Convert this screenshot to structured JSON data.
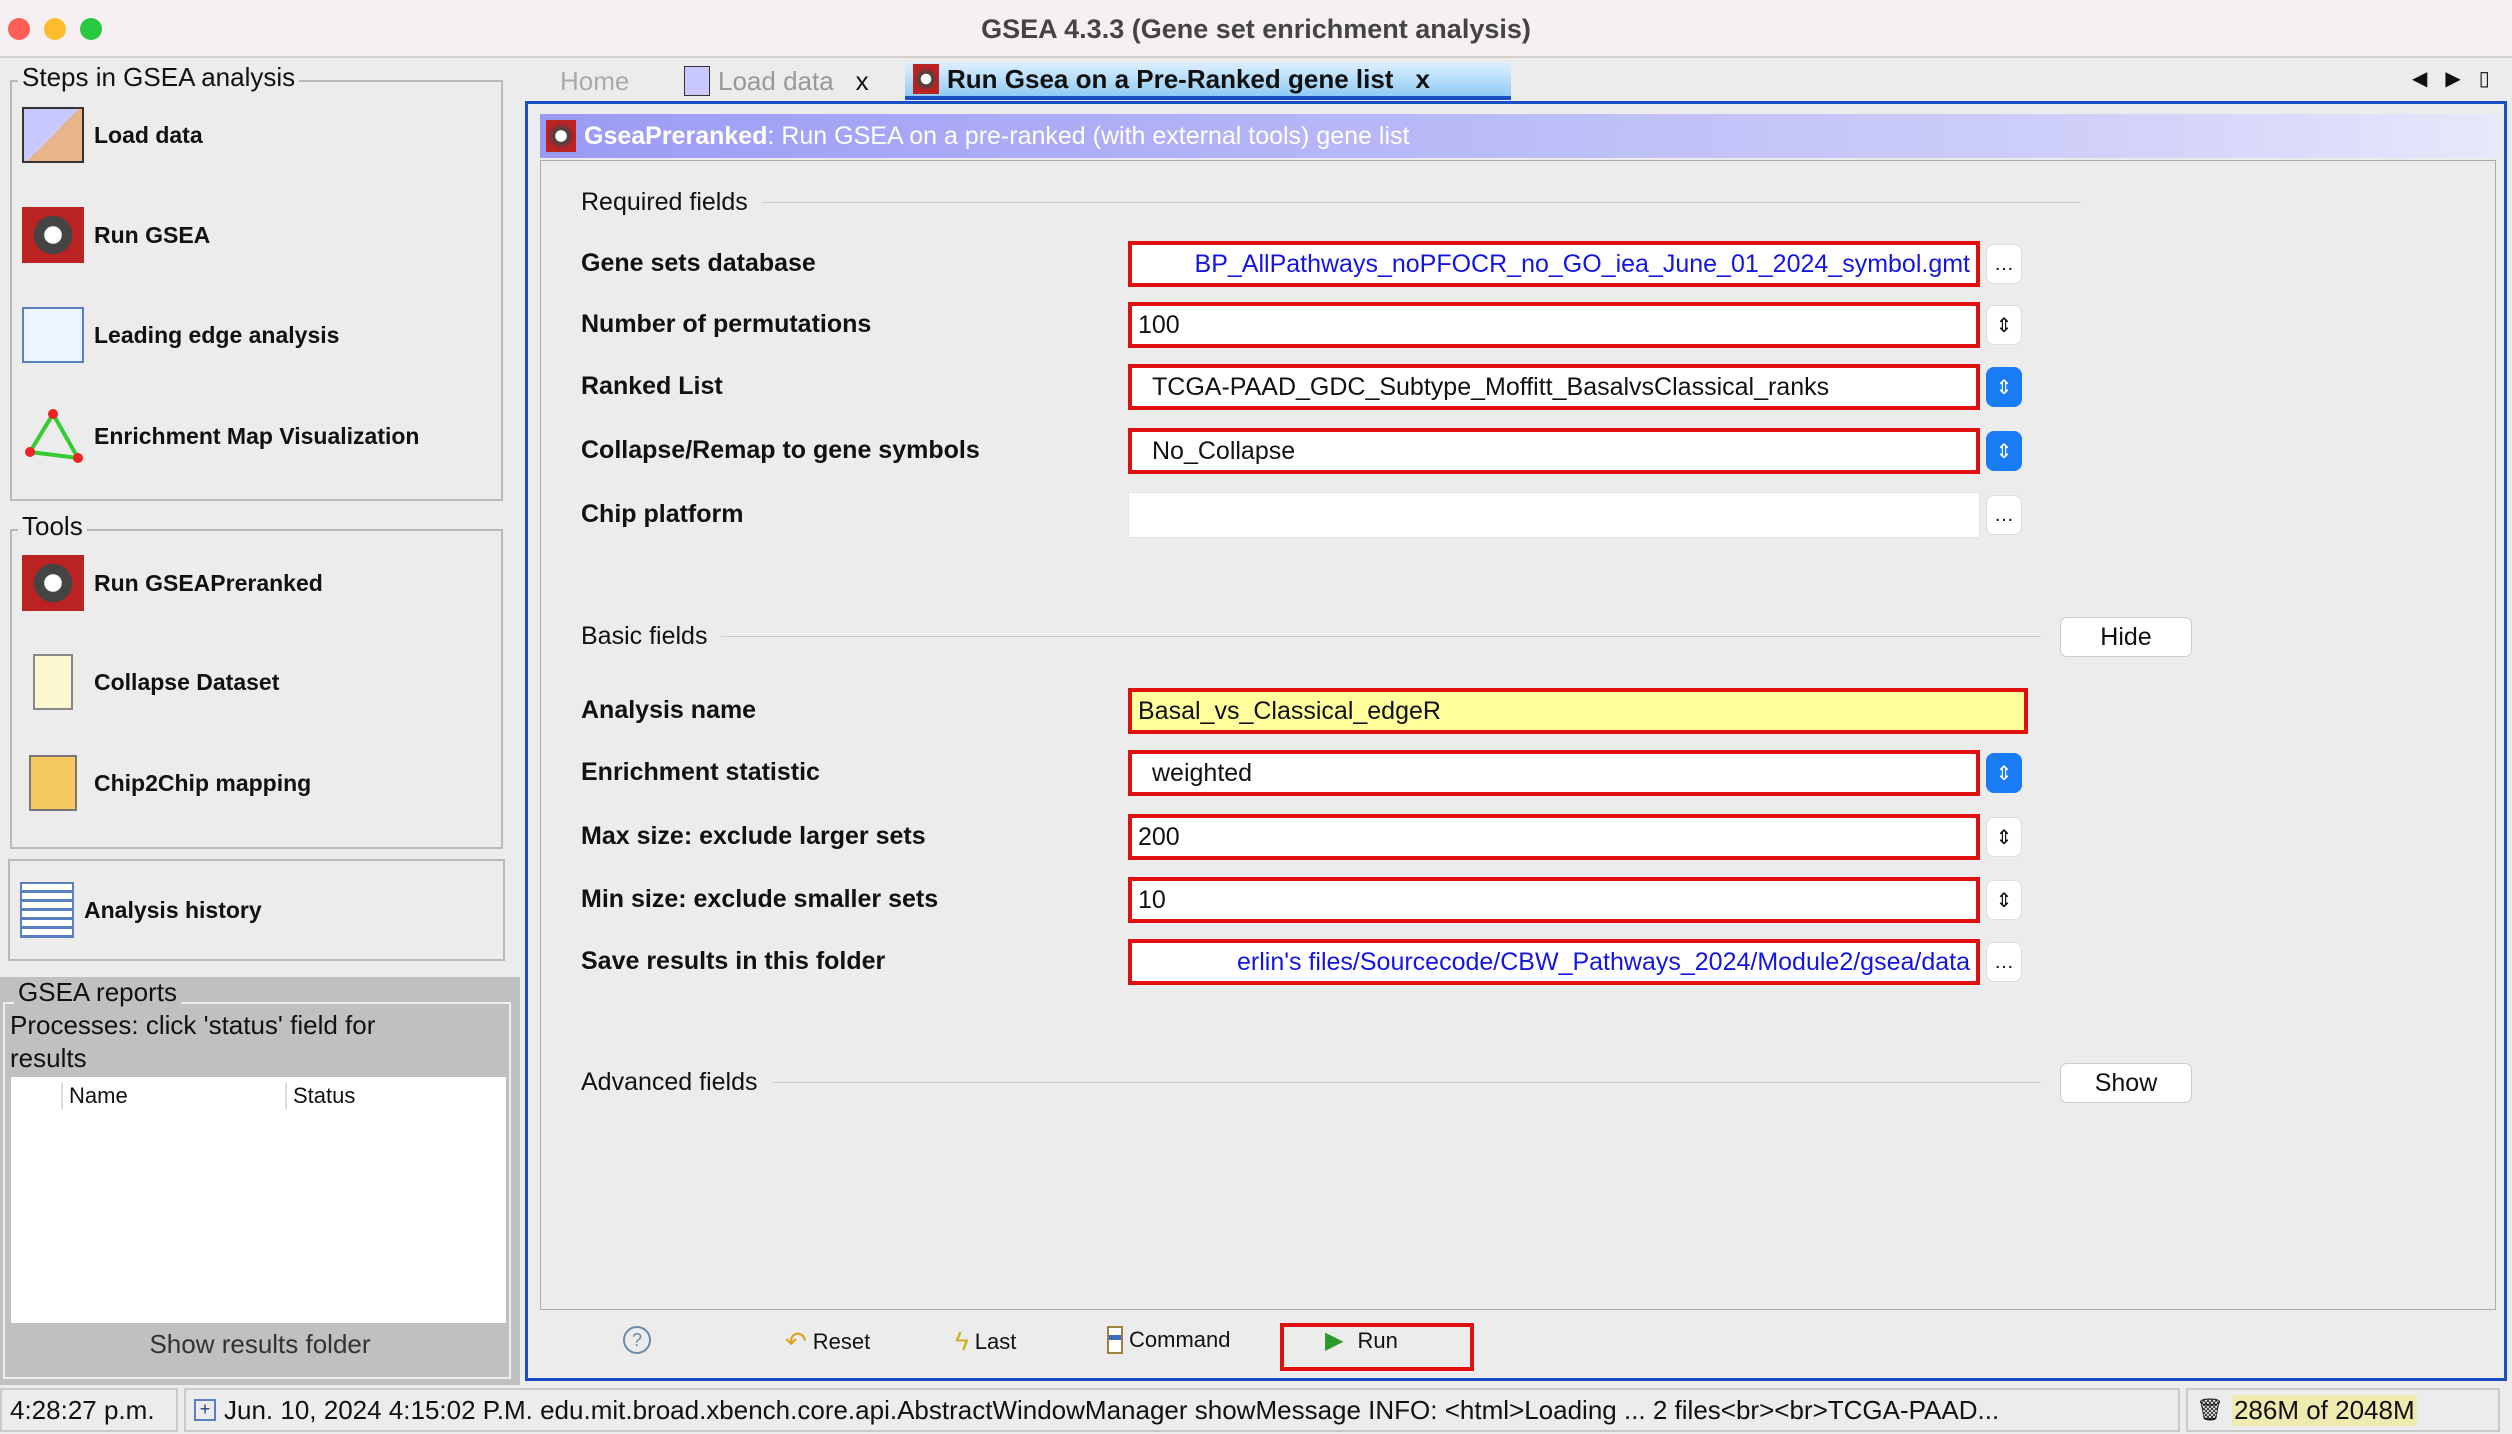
{
  "window": {
    "title": "GSEA 4.3.3 (Gene set enrichment analysis)"
  },
  "steps": {
    "title": "Steps in GSEA analysis",
    "items": [
      {
        "label": "Load data",
        "icon": "load-data-icon"
      },
      {
        "label": "Run GSEA",
        "icon": "gear-icon"
      },
      {
        "label": "Leading edge analysis",
        "icon": "leading-edge-icon"
      },
      {
        "label": "Enrichment Map Visualization",
        "icon": "triangle-network-icon"
      }
    ]
  },
  "tools": {
    "title": "Tools",
    "items": [
      {
        "label": "Run GSEAPreranked",
        "icon": "gear-icon"
      },
      {
        "label": "Collapse Dataset",
        "icon": "document-icon"
      },
      {
        "label": "Chip2Chip mapping",
        "icon": "mapping-icon"
      }
    ]
  },
  "history": {
    "label": "Analysis history"
  },
  "reports": {
    "title": "GSEA reports",
    "subtitle": "Processes: click 'status' field for results",
    "columns": [
      "Name",
      "Status"
    ],
    "button": "Show results folder"
  },
  "tabs": [
    {
      "label": "Home"
    },
    {
      "label": "Load data",
      "close": "x"
    },
    {
      "label": "Run Gsea on a Pre-Ranked gene list",
      "close": "x",
      "active": true
    }
  ],
  "panel": {
    "tool": "GseaPreranked",
    "description": ": Run GSEA on a pre-ranked (with external tools) gene list",
    "required_title": "Required fields",
    "basic_title": "Basic fields",
    "advanced_title": "Advanced fields",
    "hide": "Hide",
    "show": "Show",
    "required": [
      {
        "label": "Gene sets database",
        "value": "BP_AllPathways_noPFOCR_no_GO_iea_June_01_2024_symbol.gmt",
        "type": "file"
      },
      {
        "label": "Number of permutations",
        "value": "100",
        "type": "spinner"
      },
      {
        "label": "Ranked List",
        "value": "TCGA-PAAD_GDC_Subtype_Moffitt_BasalvsClassical_ranks",
        "type": "combo"
      },
      {
        "label": "Collapse/Remap to gene symbols",
        "value": "No_Collapse",
        "type": "combo"
      },
      {
        "label": "Chip platform",
        "value": "",
        "type": "file"
      }
    ],
    "basic": [
      {
        "label": "Analysis name",
        "value": "Basal_vs_Classical_edgeR",
        "type": "text"
      },
      {
        "label": "Enrichment statistic",
        "value": "weighted",
        "type": "combo"
      },
      {
        "label": "Max size: exclude larger sets",
        "value": "200",
        "type": "spinner"
      },
      {
        "label": "Min size: exclude smaller sets",
        "value": "10",
        "type": "spinner"
      },
      {
        "label": "Save results in this folder",
        "value": "erlin's files/Sourcecode/CBW_Pathways_2024/Module2/gsea/data",
        "type": "file"
      }
    ]
  },
  "buttons": {
    "help": "?",
    "reset": "Reset",
    "last": "Last",
    "command": "Command",
    "run": "Run"
  },
  "status": {
    "time": "4:28:27 p.m.",
    "message": "Jun. 10, 2024 4:15:02 P.M. edu.mit.broad.xbench.core.api.AbstractWindowManager showMessage INFO: <html>Loading ... 2 files<br><br>TCGA-PAAD...",
    "memory": "286M of 2048M"
  },
  "colors": {
    "accent": "#1a4fc4",
    "highlight": "#e01010",
    "analysis_name_bg": "#fefe9c"
  }
}
